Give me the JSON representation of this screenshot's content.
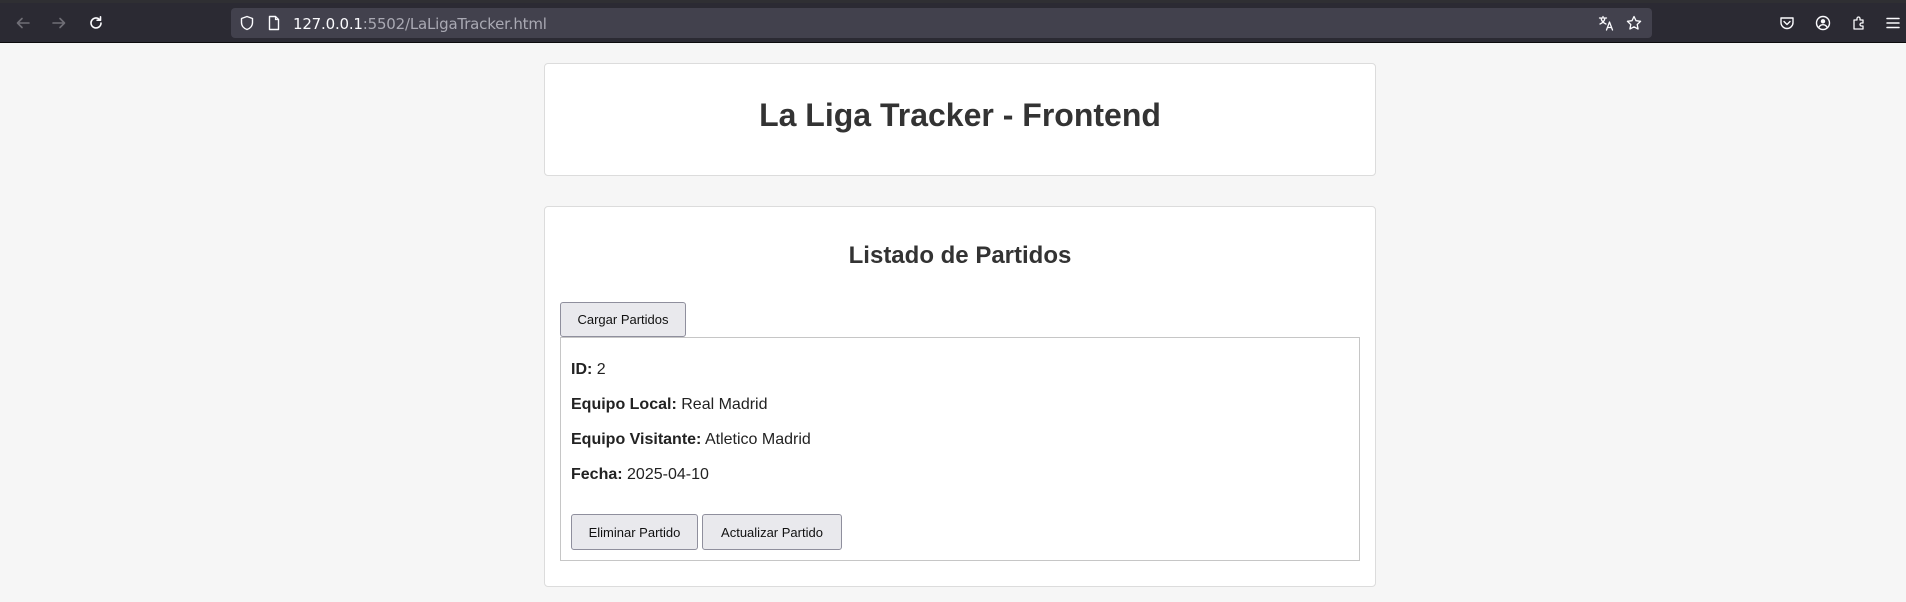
{
  "browser": {
    "url_host": "127.0.0.1",
    "url_rest": ":5502/LaLigaTracker.html"
  },
  "page": {
    "title": "La Liga Tracker - Frontend",
    "section_title": "Listado de Partidos",
    "load_button": "Cargar Partidos"
  },
  "match": {
    "id_label": "ID:",
    "id_value": "2",
    "home_label": "Equipo Local:",
    "home_value": "Real Madrid",
    "away_label": "Equipo Visitante:",
    "away_value": "Atletico Madrid",
    "date_label": "Fecha:",
    "date_value": "2025-04-10",
    "delete_button": "Eliminar Partido",
    "update_button": "Actualizar Partido"
  }
}
